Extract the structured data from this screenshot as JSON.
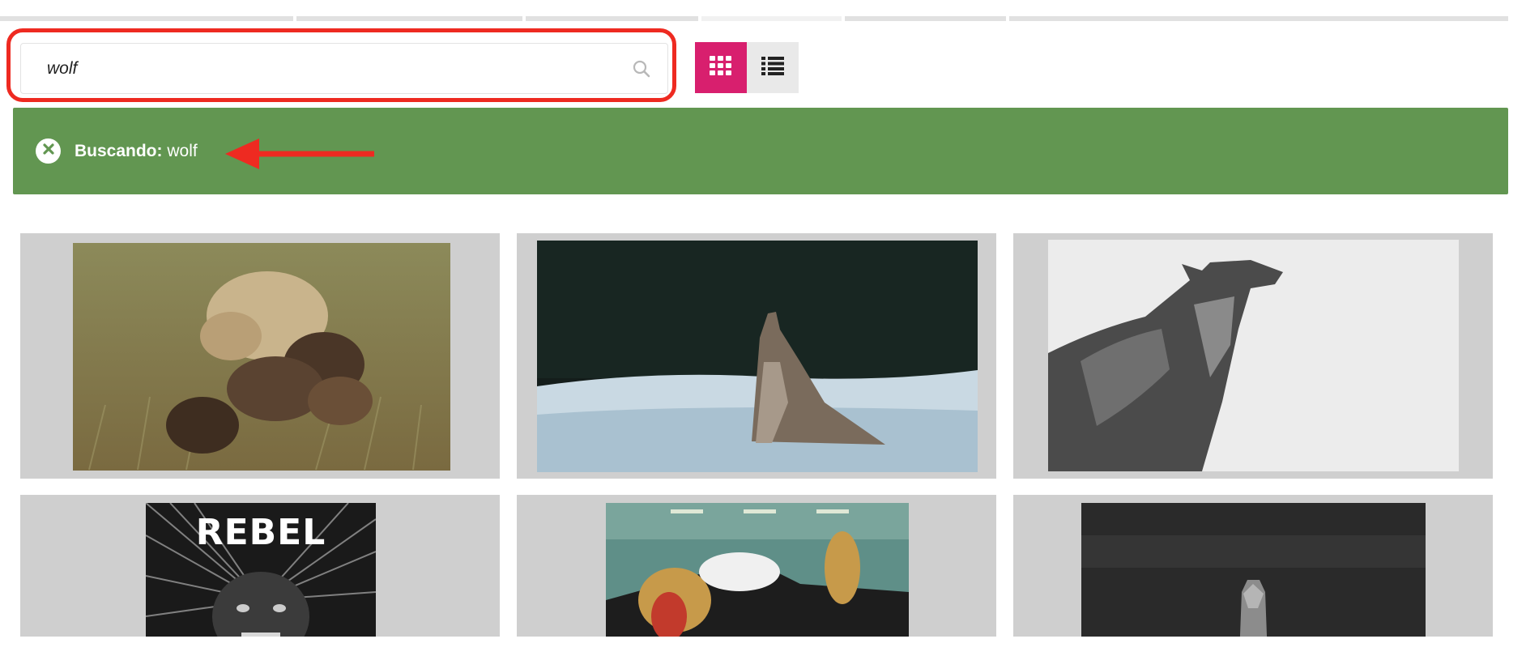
{
  "search": {
    "value": "wolf",
    "placeholder": ""
  },
  "view_toggle": {
    "grid_icon": "grid-icon",
    "list_icon": "list-icon",
    "active": "grid"
  },
  "filter_banner": {
    "label": "Buscando:",
    "term": "wolf",
    "clear_icon": "close-circle-icon"
  },
  "results": [
    {
      "description": "wolf with pups in grass"
    },
    {
      "description": "wolf howling in snow"
    },
    {
      "description": "black and white howling wolf"
    },
    {
      "description": "REBEL wolf meme",
      "overlay_text": "REBEL"
    },
    {
      "description": "cartoon wolf with mouth open"
    },
    {
      "description": "wolf in dark forest"
    }
  ],
  "colors": {
    "accent": "#d81f6e",
    "banner": "#629651",
    "highlight": "#ee2a21"
  }
}
